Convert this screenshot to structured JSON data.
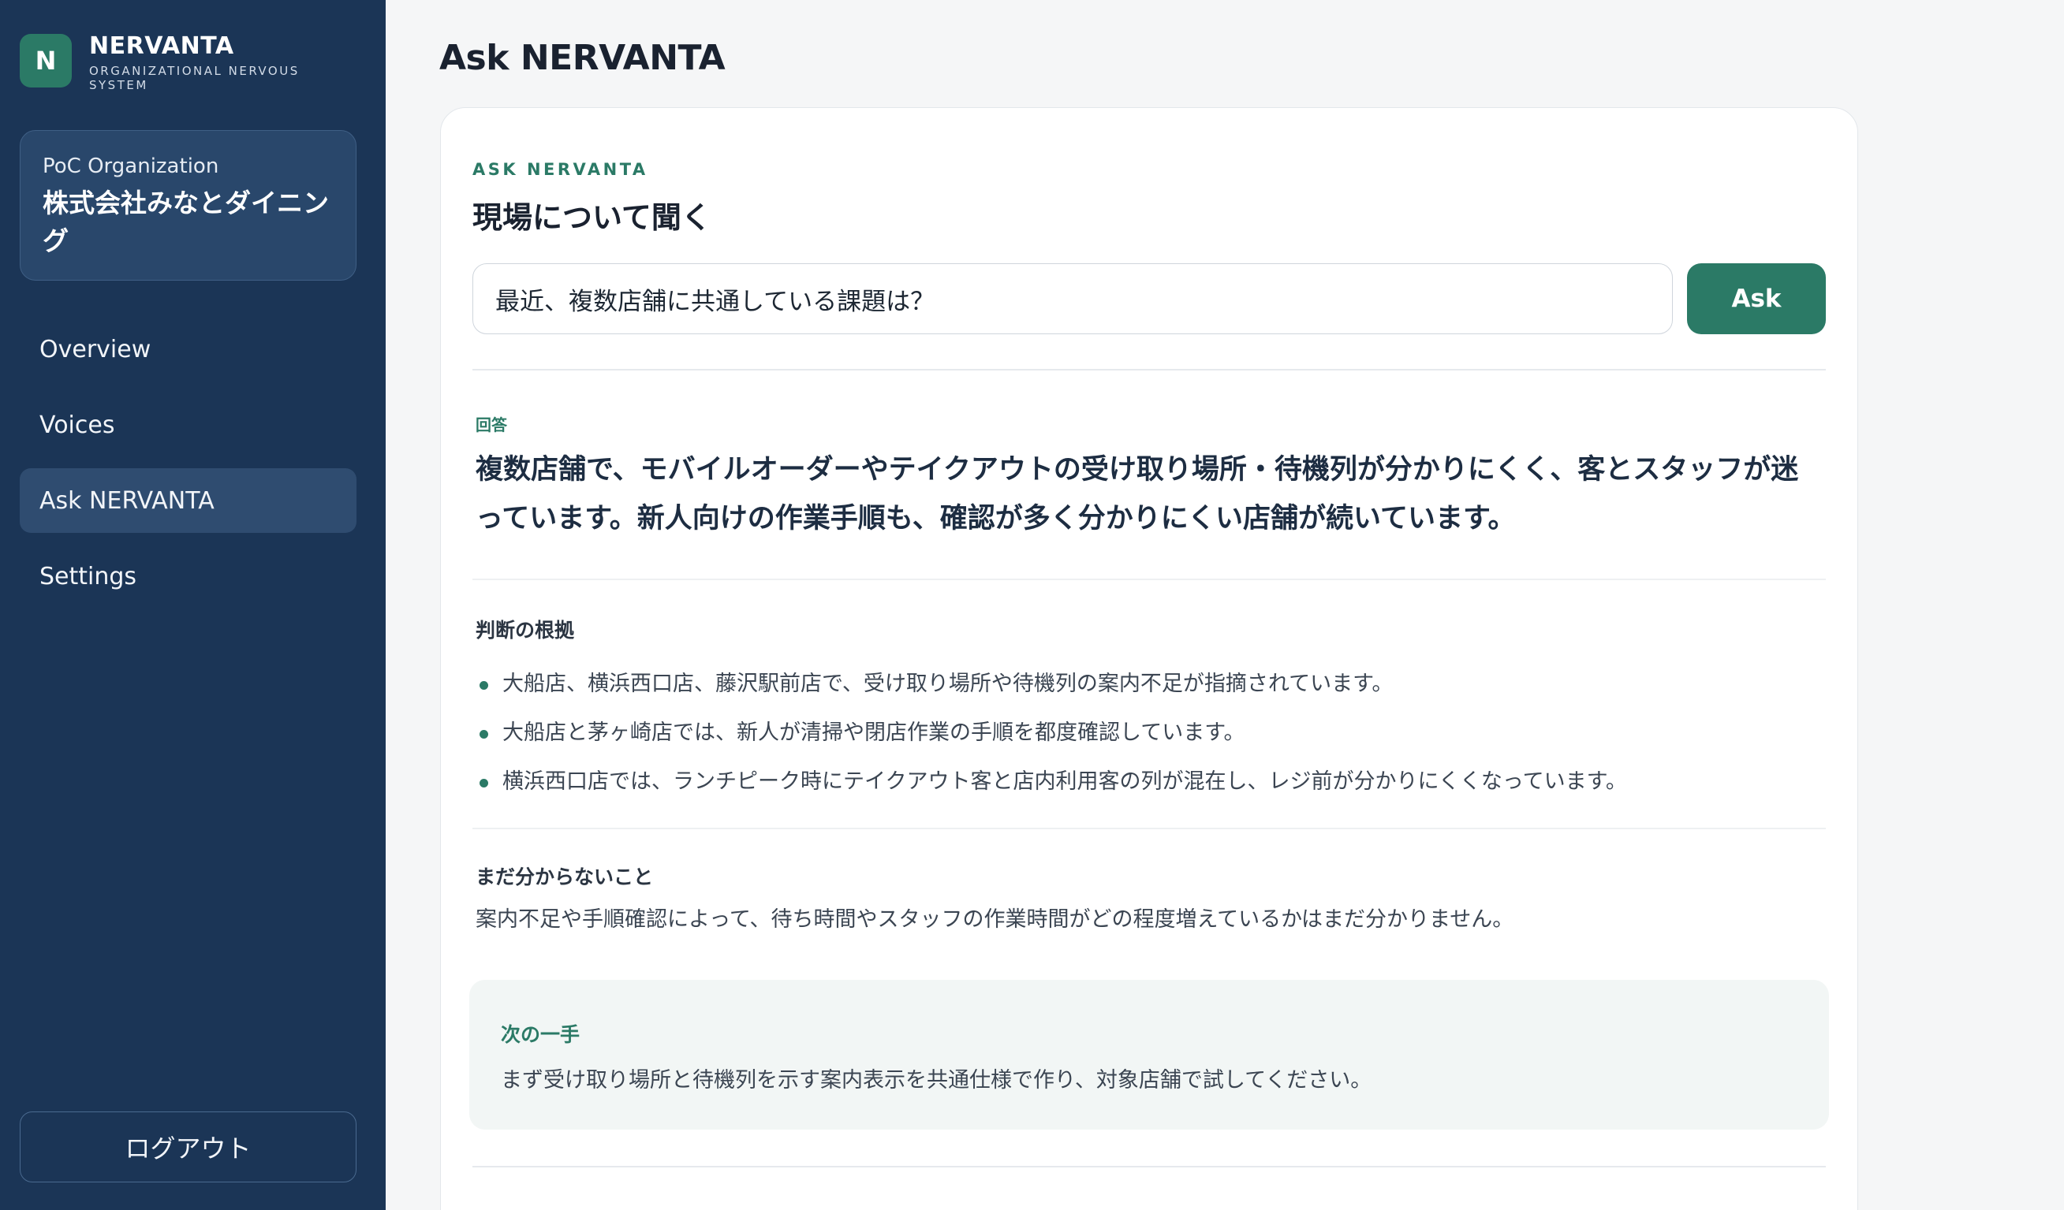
{
  "brand": {
    "logo_letter": "N",
    "name": "NERVANTA",
    "subtitle": "ORGANIZATIONAL NERVOUS SYSTEM"
  },
  "org": {
    "label": "PoC Organization",
    "name": "株式会社みなとダイニング"
  },
  "nav": {
    "items": [
      {
        "label": "Overview"
      },
      {
        "label": "Voices"
      },
      {
        "label": "Ask NERVANTA",
        "active": true
      },
      {
        "label": "Settings"
      }
    ]
  },
  "sidebar_footer": {
    "logout_label": "ログアウト"
  },
  "page": {
    "title": "Ask NERVANTA"
  },
  "ask": {
    "eyebrow": "ASK NERVANTA",
    "title": "現場について聞く",
    "input_value": "最近、複数店舗に共通している課題は？",
    "button_label": "Ask"
  },
  "answer": {
    "label": "回答",
    "text": "複数店舗で、モバイルオーダーやテイクアウトの受け取り場所・待機列が分かりにくく、客とスタッフが迷っています。新人向けの作業手順も、確認が多く分かりにくい店舗が続いています。"
  },
  "reasons": {
    "heading": "判断の根拠",
    "items": [
      "大船店、横浜西口店、藤沢駅前店で、受け取り場所や待機列の案内不足が指摘されています。",
      "大船店と茅ヶ崎店では、新人が清掃や閉店作業の手順を都度確認しています。",
      "横浜西口店では、ランチピーク時にテイクアウト客と店内利用客の列が混在し、レジ前が分かりにくくなっています。"
    ]
  },
  "unknown": {
    "heading": "まだ分からないこと",
    "text": "案内不足や手順確認によって、待ち時間やスタッフの作業時間がどの程度増えているかはまだ分かりません。"
  },
  "next_step": {
    "label": "次の一手",
    "text": "まず受け取り場所と待機列を示す案内表示を共通仕様で作り、対象店舗で試してください。"
  },
  "colors": {
    "sidebar_bg": "#1b3556",
    "accent": "#2b7a66",
    "page_bg": "#f5f6f7"
  }
}
